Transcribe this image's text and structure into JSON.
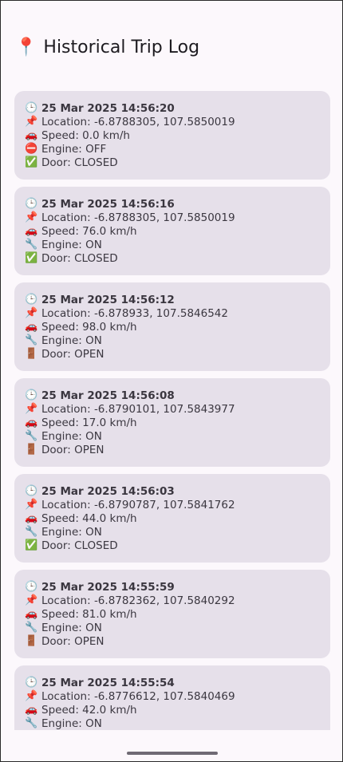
{
  "header": {
    "icon": "📍",
    "title": "Historical Trip Log"
  },
  "icons": {
    "time": "🕒",
    "location": "📌",
    "speed": "🚗",
    "engine_off": "⛔",
    "engine_on": "🔧",
    "door_closed": "✅",
    "door_open": "🚪"
  },
  "trips": [
    {
      "timestamp": "25 Mar 2025 14:56:20",
      "location": "Location: -6.8788305, 107.5850019",
      "speed": "Speed: 0.0 km/h",
      "engine": "Engine: OFF",
      "engine_icon": "⛔",
      "door": "Door: CLOSED",
      "door_icon": "✅"
    },
    {
      "timestamp": "25 Mar 2025 14:56:16",
      "location": "Location: -6.8788305, 107.5850019",
      "speed": "Speed: 76.0 km/h",
      "engine": "Engine: ON",
      "engine_icon": "🔧",
      "door": "Door: CLOSED",
      "door_icon": "✅"
    },
    {
      "timestamp": "25 Mar 2025 14:56:12",
      "location": "Location: -6.878933, 107.5846542",
      "speed": "Speed: 98.0 km/h",
      "engine": "Engine: ON",
      "engine_icon": "🔧",
      "door": "Door: OPEN",
      "door_icon": "🚪"
    },
    {
      "timestamp": "25 Mar 2025 14:56:08",
      "location": "Location: -6.8790101, 107.5843977",
      "speed": "Speed: 17.0 km/h",
      "engine": "Engine: ON",
      "engine_icon": "🔧",
      "door": "Door: OPEN",
      "door_icon": "🚪"
    },
    {
      "timestamp": "25 Mar 2025 14:56:03",
      "location": "Location: -6.8790787, 107.5841762",
      "speed": "Speed: 44.0 km/h",
      "engine": "Engine: ON",
      "engine_icon": "🔧",
      "door": "Door: CLOSED",
      "door_icon": "✅"
    },
    {
      "timestamp": "25 Mar 2025 14:55:59",
      "location": "Location: -6.8782362, 107.5840292",
      "speed": "Speed: 81.0 km/h",
      "engine": "Engine: ON",
      "engine_icon": "🔧",
      "door": "Door: OPEN",
      "door_icon": "🚪"
    },
    {
      "timestamp": "25 Mar 2025 14:55:54",
      "location": "Location: -6.8776612, 107.5840469",
      "speed": "Speed: 42.0 km/h",
      "engine": "Engine: ON",
      "engine_icon": "🔧"
    }
  ]
}
